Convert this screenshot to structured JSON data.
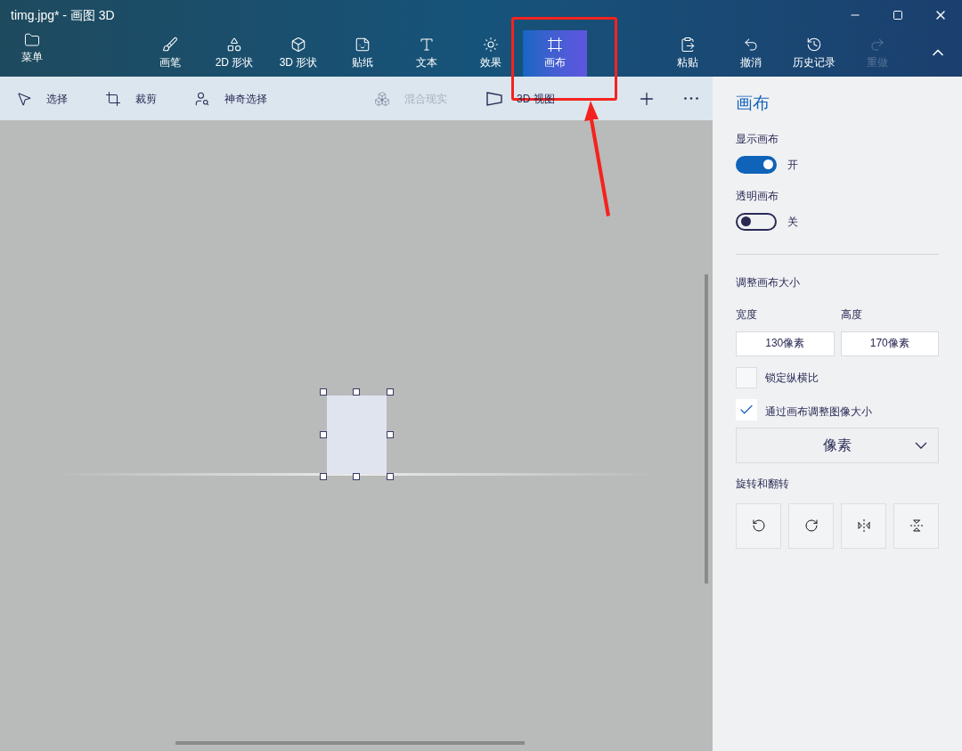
{
  "window": {
    "title": "timg.jpg* - 画图 3D"
  },
  "menu_button": {
    "label": "菜单"
  },
  "ribbon_tools": [
    {
      "label": "画笔",
      "selected": false
    },
    {
      "label": "2D 形状",
      "selected": false
    },
    {
      "label": "3D 形状",
      "selected": false
    },
    {
      "label": "贴纸",
      "selected": false
    },
    {
      "label": "文本",
      "selected": false
    },
    {
      "label": "效果",
      "selected": false
    },
    {
      "label": "画布",
      "selected": true
    }
  ],
  "ribbon_actions": [
    {
      "label": "粘贴",
      "disabled": false
    },
    {
      "label": "撤消",
      "disabled": false
    },
    {
      "label": "历史记录",
      "disabled": false
    },
    {
      "label": "重做",
      "disabled": true
    }
  ],
  "toolbar": [
    {
      "label": "选择",
      "disabled": false
    },
    {
      "label": "裁剪",
      "disabled": false
    },
    {
      "label": "神奇选择",
      "disabled": false
    },
    {
      "label": "混合现实",
      "disabled": true
    },
    {
      "label": "3D 视图",
      "disabled": false
    }
  ],
  "panel": {
    "title": "画布",
    "toggles": [
      {
        "label": "显示画布",
        "on": true,
        "state_text": "开"
      },
      {
        "label": "透明画布",
        "on": false,
        "state_text": "关"
      }
    ],
    "resize_heading": "调整画布大小",
    "fields": [
      {
        "label": "宽度",
        "value": "130像素"
      },
      {
        "label": "高度",
        "value": "170像素"
      }
    ],
    "checkboxes": [
      {
        "label": "锁定纵横比",
        "checked": false
      },
      {
        "label": "通过画布调整图像大小",
        "checked": true
      }
    ],
    "unit_dropdown": {
      "value": "像素"
    },
    "rotate_heading": "旋转和翻转"
  }
}
